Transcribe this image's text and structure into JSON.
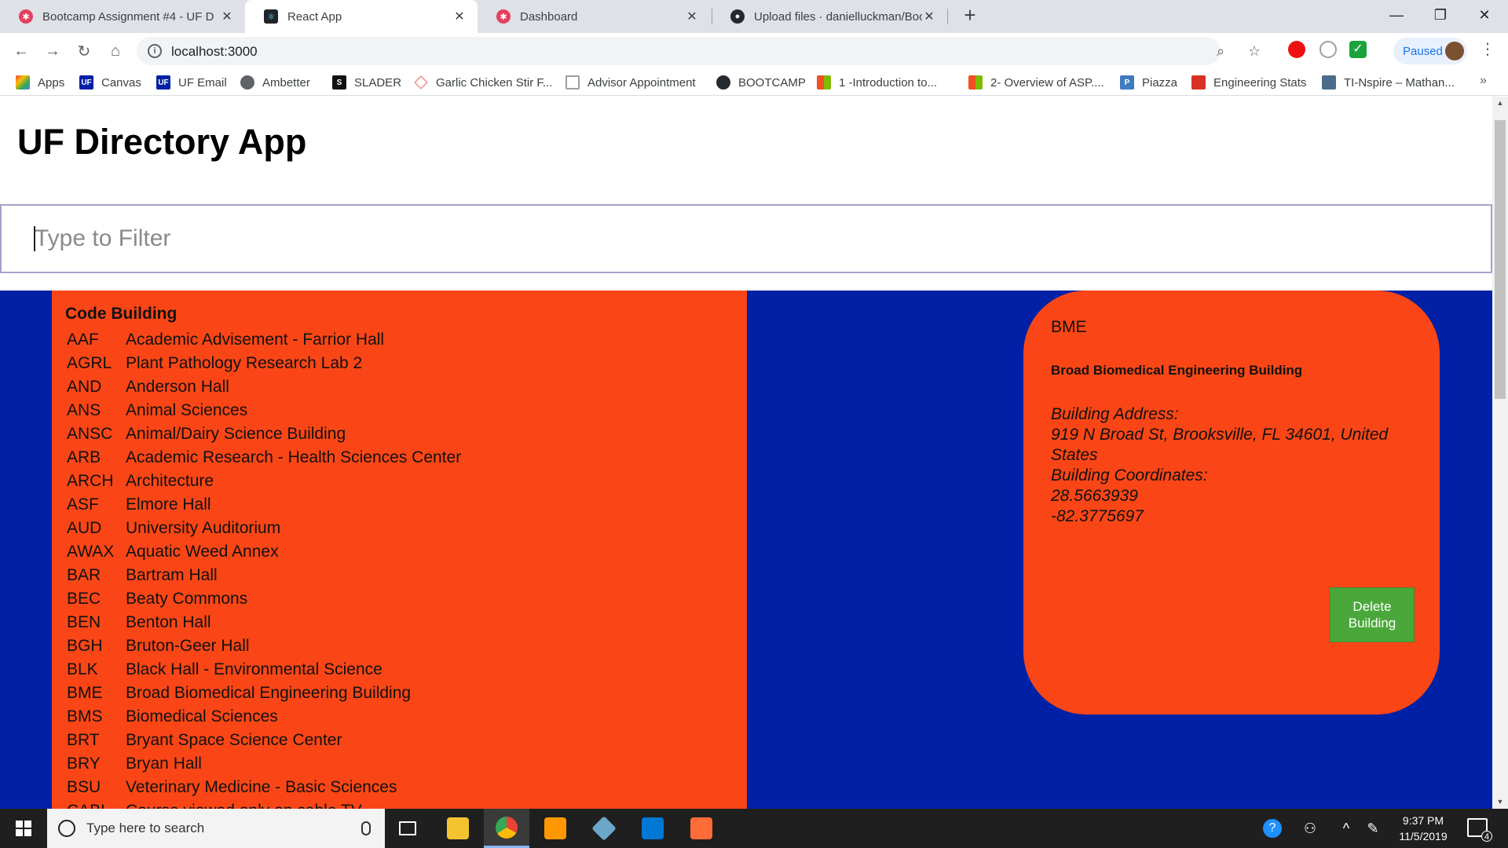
{
  "browser": {
    "tabs": [
      {
        "title": "Bootcamp Assignment #4 - UF D",
        "favicon_color": "#e4405f",
        "active": false
      },
      {
        "title": "React App",
        "favicon_color": "#20232a",
        "active": true
      },
      {
        "title": "Dashboard",
        "favicon_color": "#e4405f",
        "active": false
      },
      {
        "title": "Upload files · danielluckman/Boo",
        "favicon_color": "#24292e",
        "active": false
      }
    ],
    "url": "localhost:3000",
    "profile_status": "Paused",
    "bookmarks": [
      {
        "label": "Apps",
        "color": "#ea4335"
      },
      {
        "label": "Canvas",
        "color": "#0021a5",
        "icon_text": "UF"
      },
      {
        "label": "UF Email",
        "color": "#0021a5",
        "icon_text": "UF"
      },
      {
        "label": "Ambetter",
        "color": "#5f6368"
      },
      {
        "label": "SLADER",
        "color": "#111111",
        "icon_text": "S"
      },
      {
        "label": "Garlic Chicken Stir F...",
        "color": "#f28b82"
      },
      {
        "label": "Advisor Appointment",
        "color": "#9aa0a6"
      },
      {
        "label": "BOOTCAMP",
        "color": "#24292e"
      },
      {
        "label": "1 -Introduction to...",
        "color": "#f25022"
      },
      {
        "label": "2- Overview of ASP....",
        "color": "#f25022"
      },
      {
        "label": "Piazza",
        "color": "#3e7bbf",
        "icon_text": "P"
      },
      {
        "label": "Engineering Stats",
        "color": "#d93025"
      },
      {
        "label": "TI-Nspire – Mathan...",
        "color": "#4a6b8a"
      }
    ]
  },
  "app": {
    "title": "UF Directory App",
    "filter_placeholder": "Type to Filter",
    "list_header": "Code Building",
    "buildings": [
      {
        "code": "AAF",
        "name": "Academic Advisement - Farrior Hall"
      },
      {
        "code": "AGRL",
        "name": "Plant Pathology Research Lab 2"
      },
      {
        "code": "AND",
        "name": "Anderson Hall"
      },
      {
        "code": "ANS",
        "name": "Animal Sciences"
      },
      {
        "code": "ANSC",
        "name": "Animal/Dairy Science Building"
      },
      {
        "code": "ARB",
        "name": "Academic Research - Health Sciences Center"
      },
      {
        "code": "ARCH",
        "name": "Architecture"
      },
      {
        "code": "ASF",
        "name": "Elmore Hall"
      },
      {
        "code": "AUD",
        "name": "University Auditorium"
      },
      {
        "code": "AWAX",
        "name": "Aquatic Weed Annex"
      },
      {
        "code": "BAR",
        "name": "Bartram Hall"
      },
      {
        "code": "BEC",
        "name": "Beaty Commons"
      },
      {
        "code": "BEN",
        "name": "Benton Hall"
      },
      {
        "code": "BGH",
        "name": "Bruton-Geer Hall"
      },
      {
        "code": "BLK",
        "name": "Black Hall - Environmental Science"
      },
      {
        "code": "BME",
        "name": "Broad Biomedical Engineering Building"
      },
      {
        "code": "BMS",
        "name": "Biomedical Sciences"
      },
      {
        "code": "BRT",
        "name": "Bryant Space Science Center"
      },
      {
        "code": "BRY",
        "name": "Bryan Hall"
      },
      {
        "code": "BSU",
        "name": "Veterinary Medicine - Basic Sciences"
      },
      {
        "code": "CABL",
        "name": "Course viewed only on cable TV"
      }
    ],
    "selected": {
      "code": "BME",
      "name": "Broad Biomedical Engineering Building",
      "address_label": "Building Address:",
      "address": "919 N Broad St, Brooksville, FL 34601, United States",
      "coords_label": "Building Coordinates:",
      "latitude": "28.5663939",
      "longitude": "-82.3775697",
      "delete_label": "Delete Building"
    },
    "colors": {
      "uf_orange": "#fa4616",
      "uf_blue": "#0021a5",
      "delete_green": "#4aa83a"
    }
  },
  "taskbar": {
    "search_placeholder": "Type here to search",
    "time": "9:37 PM",
    "date": "11/5/2019",
    "notification_count": "4"
  }
}
